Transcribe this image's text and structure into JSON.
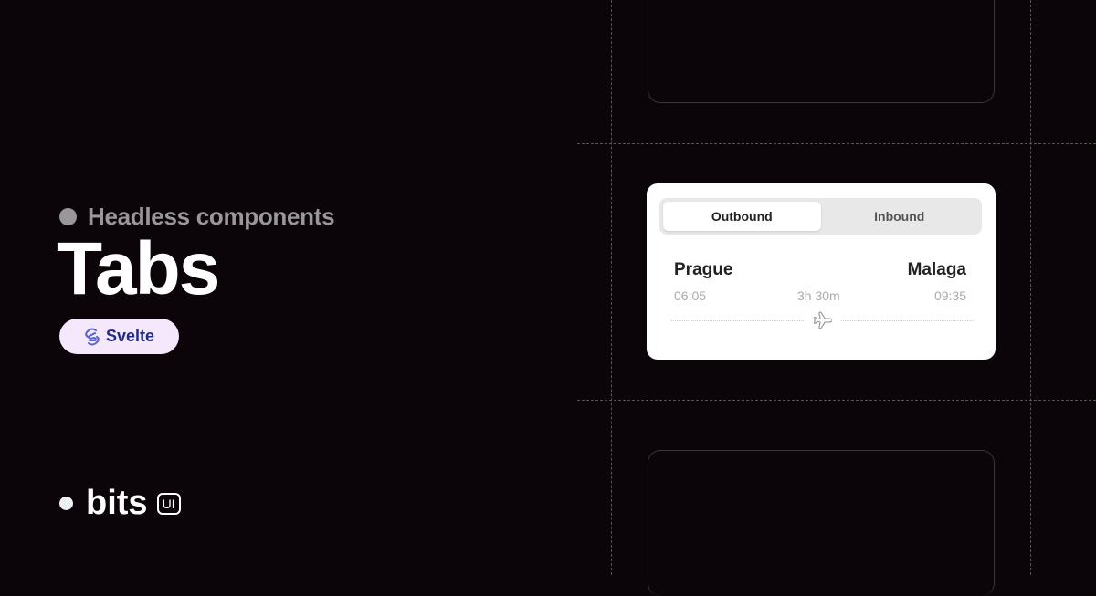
{
  "hero": {
    "tagline": "Headless components",
    "title": "Tabs",
    "framework_badge": "Svelte"
  },
  "brand": {
    "name": "bits",
    "suffix": "UI"
  },
  "demo": {
    "tabs": [
      {
        "label": "Outbound",
        "active": true
      },
      {
        "label": "Inbound",
        "active": false
      }
    ],
    "flight": {
      "origin": "Prague",
      "destination": "Malaga",
      "departure": "06:05",
      "duration": "3h 30m",
      "arrival": "09:35"
    }
  }
}
